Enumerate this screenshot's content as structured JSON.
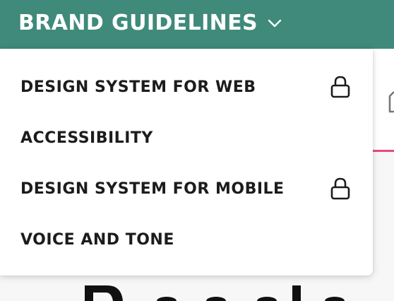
{
  "header": {
    "title": "BRAND GUIDELINES",
    "chevron_icon": "chevron-down-icon",
    "background_color": "#3f8a7a"
  },
  "dropdown": {
    "items": [
      {
        "label": "DESIGN SYSTEM FOR WEB",
        "locked": true,
        "icon": "lock-icon"
      },
      {
        "label": "ACCESSIBILITY",
        "locked": false
      },
      {
        "label": "DESIGN SYSTEM FOR MOBILE",
        "locked": true,
        "icon": "lock-icon"
      },
      {
        "label": "VOICE AND TONE",
        "locked": false
      }
    ]
  },
  "background_page": {
    "accent_color": "#e84b7a"
  }
}
